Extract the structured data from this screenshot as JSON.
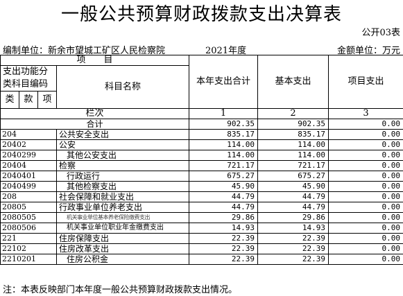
{
  "title": "一般公共预算财政拨款支出决算表",
  "form_no": "公开03表",
  "unit": {
    "org": "编制单位：新余市望城工矿区人民检察院",
    "year": "2021年度",
    "currency": "金额单位：万元"
  },
  "header": {
    "item": "项　　目",
    "code_group": "支出功能分类科目编码",
    "lei": "类",
    "kuan": "款",
    "xiang": "项",
    "name": "科目名称",
    "col_total": "本年支出合计",
    "col_basic": "基本支出",
    "col_project": "项目支出",
    "lanci": "栏次",
    "n1": "1",
    "n2": "2",
    "n3": "3"
  },
  "total": {
    "label": "合计",
    "total": "902.35",
    "basic": "902.35",
    "project": "0.00"
  },
  "rows": [
    {
      "code": "204",
      "name": "公共安全支出",
      "total": "835.17",
      "basic": "835.17",
      "project": "0.00"
    },
    {
      "code": "20402",
      "name": "公安",
      "total": "114.00",
      "basic": "114.00",
      "project": "0.00"
    },
    {
      "code": "2040299",
      "name": "其他公安支出",
      "total": "114.00",
      "basic": "114.00",
      "project": "0.00"
    },
    {
      "code": "20404",
      "name": "检察",
      "total": "721.17",
      "basic": "721.17",
      "project": "0.00"
    },
    {
      "code": "2040401",
      "name": "行政运行",
      "total": "675.27",
      "basic": "675.27",
      "project": "0.00"
    },
    {
      "code": "2040499",
      "name": "其他检察支出",
      "total": "45.90",
      "basic": "45.90",
      "project": "0.00"
    },
    {
      "code": "208",
      "name": "社会保障和就业支出",
      "total": "44.79",
      "basic": "44.79",
      "project": "0.00"
    },
    {
      "code": "20805",
      "name": "行政事业单位养老支出",
      "total": "44.79",
      "basic": "44.79",
      "project": "0.00"
    },
    {
      "code": "2080505",
      "name": "机关事业单位基本养老保险缴费支出",
      "total": "29.86",
      "basic": "29.86",
      "project": "0.00"
    },
    {
      "code": "2080506",
      "name": "机关事业单位职业年金缴费支出",
      "total": "14.93",
      "basic": "14.93",
      "project": "0.00"
    },
    {
      "code": "221",
      "name": "住房保障支出",
      "total": "22.39",
      "basic": "22.39",
      "project": "0.00"
    },
    {
      "code": "22102",
      "name": "住房改革支出",
      "total": "22.39",
      "basic": "22.39",
      "project": "0.00"
    },
    {
      "code": "2210201",
      "name": "住房公积金",
      "total": "22.39",
      "basic": "22.39",
      "project": "0.00"
    }
  ],
  "note": "注：本表反映部门本年度一般公共预算财政拨款支出情况。"
}
